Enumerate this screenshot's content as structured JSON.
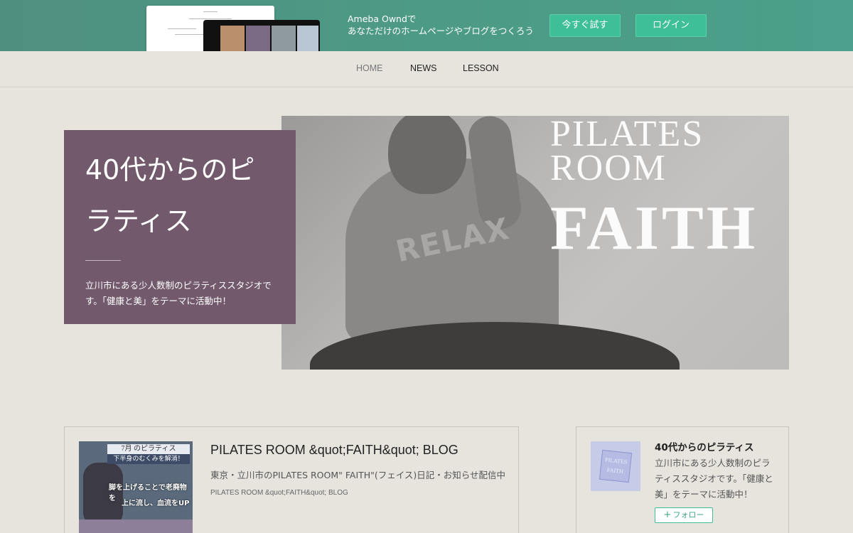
{
  "promo": {
    "line1": "Ameba Owndで",
    "line2": "あなただけのホームページやブログをつくろう",
    "try_label": "今すぐ試す",
    "login_label": "ログイン"
  },
  "nav": {
    "items": [
      {
        "label": "HOME",
        "active": true
      },
      {
        "label": "NEWS",
        "active": false
      },
      {
        "label": "LESSON",
        "active": false
      }
    ]
  },
  "hero": {
    "title": "40代からのピラティス",
    "description": "立川市にある少人数制のピラティススタジオです。「健康と美」をテーマに活動中！",
    "image_text": {
      "relax": "RELAX",
      "line1": "PILATES",
      "line2": "ROOM",
      "line3": "FAITH"
    },
    "card_color": "#725a6c"
  },
  "blog": {
    "title": "PILATES ROOM &quot;FAITH&quot; BLOG",
    "description": "東京・立川市のPILATES ROOM\" FAITH\"(フェイス)日記・お知らせ配信中",
    "subtitle": "PILATES ROOM &quot;FAITH&quot; BLOG",
    "thumb": {
      "heading": "7月 のピラティス",
      "banner": "下半身のむくみを解消！",
      "caption1": "脚を上げることで老廃物を",
      "caption2": "上に流し、血流をUP"
    }
  },
  "profile": {
    "name": "40代からのピラティス",
    "description": "立川市にある少人数制のピラティススタジオです。「健康と美」をテーマに活動中！",
    "follow_label": "フォロー",
    "avatar_text": "PILATES FAITH"
  },
  "colors": {
    "accent": "#3fbf98",
    "banner": "#4d9a86",
    "background": "#e7e3dd"
  }
}
